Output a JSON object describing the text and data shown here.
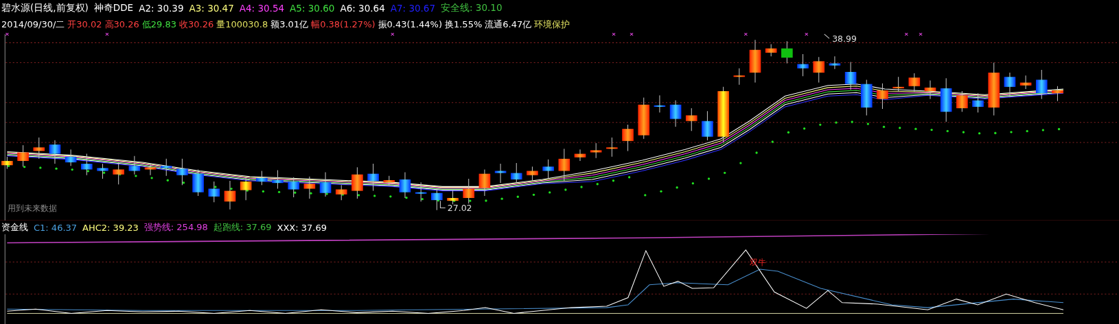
{
  "title_line": {
    "title": "碧水源(日线,前复权)",
    "indicator": "神奇DDE",
    "values": [
      {
        "label": "A2:",
        "value": "30.39",
        "color": "#ffffff"
      },
      {
        "label": "A3:",
        "value": "30.47",
        "color": "#ffff80"
      },
      {
        "label": "A4:",
        "value": "30.54",
        "color": "#ff40ff"
      },
      {
        "label": "A5:",
        "value": "30.60",
        "color": "#40e040"
      },
      {
        "label": "A6:",
        "value": "30.64",
        "color": "#ffffff"
      },
      {
        "label": "A7:",
        "value": "30.67",
        "color": "#2020ff"
      },
      {
        "label": "安全线:",
        "value": "30.10",
        "color": "#40c040"
      }
    ]
  },
  "quote_line": {
    "date": "2014/09/30/二",
    "items": [
      {
        "label": "开",
        "value": "30.02",
        "color": "#ff4040"
      },
      {
        "label": "高",
        "value": "30.26",
        "color": "#ff4040"
      },
      {
        "label": "低",
        "value": "29.83",
        "color": "#40e040"
      },
      {
        "label": "收",
        "value": "30.26",
        "color": "#ff4040"
      },
      {
        "label": "量",
        "value": "100030.8",
        "color": "#e0e060"
      },
      {
        "label": "额",
        "value": "3.01亿",
        "color": "#ffffff"
      },
      {
        "label": "幅",
        "value": "0.38(1.27%)",
        "color": "#ff4040"
      },
      {
        "label": "振",
        "value": "0.43(1.44%)",
        "color": "#ffffff"
      },
      {
        "label": "换",
        "value": "1.55%",
        "color": "#ffffff"
      },
      {
        "label": "流通",
        "value": "6.47亿",
        "color": "#ffffff"
      }
    ],
    "sector": "环境保护"
  },
  "main_chart": {
    "high_label": "38.99",
    "low_label": "27.02",
    "note": "用到未来数据"
  },
  "sub_chart": {
    "name": "资金线",
    "values": [
      {
        "label": "C1:",
        "value": "46.37",
        "color": "#4aa0e0"
      },
      {
        "label": "AHC2:",
        "value": "39.23",
        "color": "#ffff80"
      },
      {
        "label": "强势线:",
        "value": "254.98",
        "color": "#e040e0"
      },
      {
        "label": "起跑线:",
        "value": "37.69",
        "color": "#40c040"
      },
      {
        "label": "XXX:",
        "value": "37.69",
        "color": "#ffffff"
      }
    ],
    "signal_label": "双牛"
  }
}
